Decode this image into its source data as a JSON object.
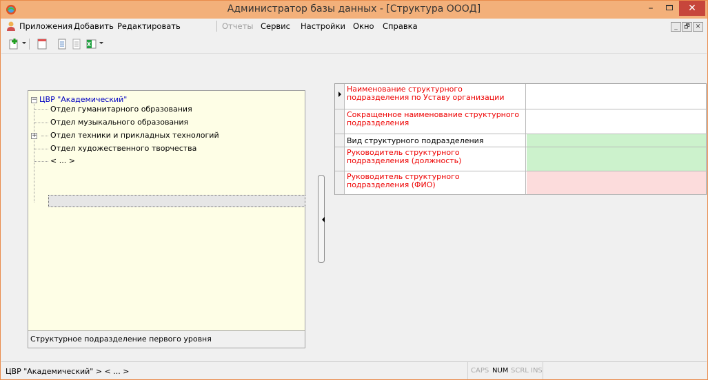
{
  "window": {
    "title": "Администратор базы данных - [Структура ОООД]",
    "minimize_glyph": "–",
    "close_glyph": "✕",
    "accent_color": "#f3b07a",
    "close_color": "#c7463b"
  },
  "menu": {
    "items": [
      "Приложения",
      "Добавить",
      "Редактировать",
      "Отчеты",
      "Сервис",
      "Настройки",
      "Окно",
      "Справка"
    ],
    "disabled_item": "Отчеты",
    "mdi_buttons": [
      "_",
      "🗗",
      "✕"
    ]
  },
  "toolbar": {
    "icons": [
      "add-icon",
      "dropdown-arrow-icon",
      "document-icon",
      "page-icon",
      "copy-icon",
      "excel-icon",
      "dropdown-arrow-icon"
    ]
  },
  "tree": {
    "root": "ЦВР \"Академический\"",
    "root_expander": "−",
    "children": [
      {
        "label": "Отдел гуманитарного образования",
        "expander": ""
      },
      {
        "label": "Отдел музыкального образования",
        "expander": ""
      },
      {
        "label": "Отдел техники и прикладных технологий",
        "expander": "+"
      },
      {
        "label": "Отдел художественного творчества",
        "expander": ""
      },
      {
        "label": "< ... >",
        "expander": ""
      }
    ],
    "caption": "Структурное подразделение первого уровня",
    "background": "#fefee6"
  },
  "properties": {
    "rows": [
      {
        "label": "Наименование структурного подразделения по Уставу организации",
        "required": true,
        "value_color": "#ffffff",
        "value": ""
      },
      {
        "label": "Сокращенное наименование структурного подразделения",
        "required": true,
        "value_color": "#ffffff",
        "value": ""
      },
      {
        "label": "Вид структурного подразделения",
        "required": false,
        "value_color": "#ccf2cc",
        "value": ""
      },
      {
        "label": "Руководитель структурного подразделения (должность)",
        "required": true,
        "value_color": "#ccf2cc",
        "value": ""
      },
      {
        "label": "Руководитель структурного подразделения (ФИО)",
        "required": true,
        "value_color": "#fcdcdc",
        "value": ""
      }
    ]
  },
  "status": {
    "path": "ЦВР \"Академический\" > < ... >",
    "keys": [
      {
        "label": "CAPS",
        "active": false
      },
      {
        "label": "NUM",
        "active": true
      },
      {
        "label": "SCRL",
        "active": false
      },
      {
        "label": "INS",
        "active": false
      }
    ]
  }
}
